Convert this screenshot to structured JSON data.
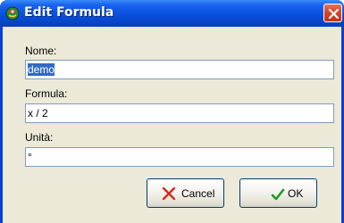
{
  "window": {
    "title": "Edit Formula",
    "icon": "formula-app-icon"
  },
  "form": {
    "nome_label": "Nome:",
    "nome_value": "demo",
    "formula_label": "Formula:",
    "formula_value": "x / 2",
    "unita_label": "Unità:",
    "unita_value": "°"
  },
  "buttons": {
    "cancel_label": "Cancel",
    "cancel_icon": "red-x-icon",
    "ok_label": "OK",
    "ok_icon": "green-check-icon"
  },
  "colors": {
    "titlebar": "#0a52e0",
    "dialog_background": "#ece9d8",
    "close_button": "#d8452a",
    "selection": "#316ac5"
  }
}
